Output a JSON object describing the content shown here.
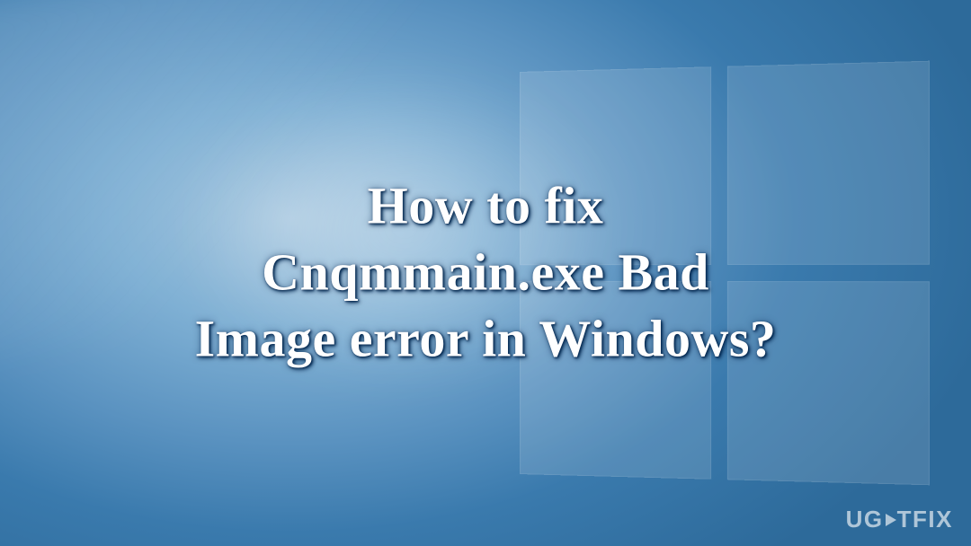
{
  "title": {
    "line1": "How to fix",
    "line2": "Cnqmmain.exe Bad",
    "line3": "Image error in Windows?"
  },
  "watermark": {
    "prefix": "UG",
    "suffix": "TFIX"
  }
}
